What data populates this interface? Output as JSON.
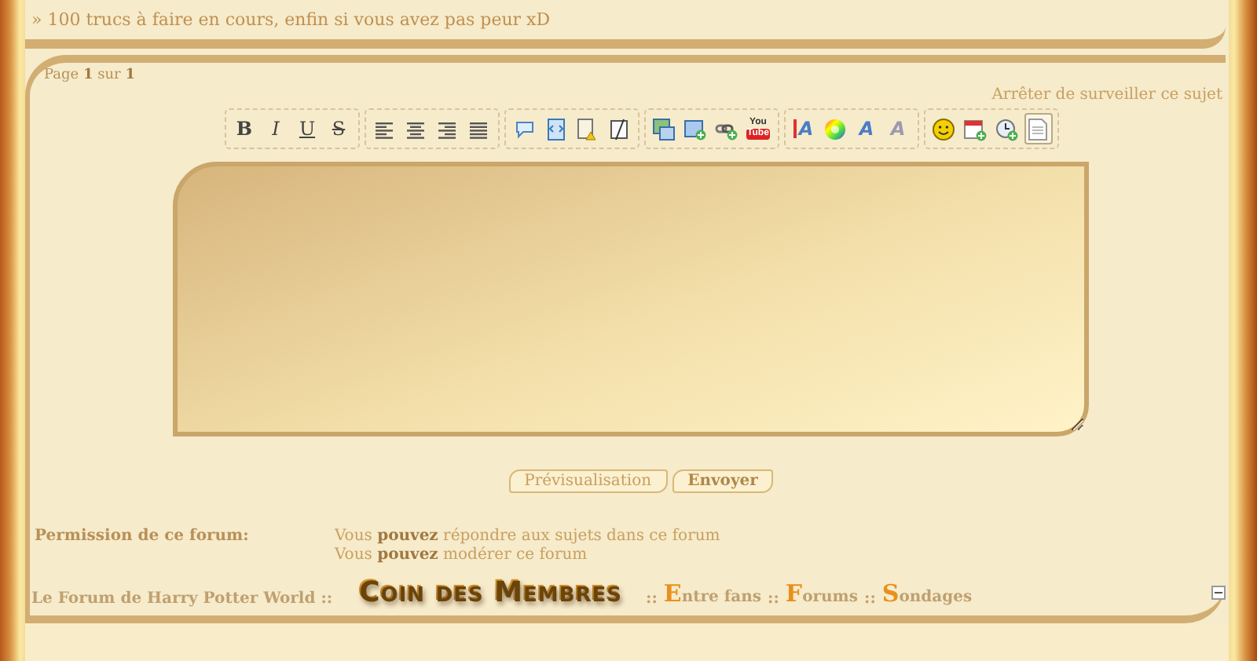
{
  "previous_post": {
    "text": "» 100 trucs à faire en cours, enfin si vous avez pas peur xD"
  },
  "pagination": {
    "text": "Page **1** sur **1**"
  },
  "watch_link": {
    "label": "Arrêter de surveiller ce sujet"
  },
  "toolbar": {
    "groups": [
      {
        "buttons": [
          {
            "kind": "bold",
            "label": "B",
            "selected": false
          },
          {
            "kind": "italic",
            "label": "I",
            "selected": false
          },
          {
            "kind": "underline",
            "label": "U",
            "selected": false
          },
          {
            "kind": "strike",
            "label": "S",
            "selected": false
          }
        ]
      },
      {
        "buttons": [
          {
            "kind": "align-left",
            "selected": false
          },
          {
            "kind": "align-center",
            "selected": false
          },
          {
            "kind": "align-right",
            "selected": false
          },
          {
            "kind": "justify",
            "selected": false
          }
        ]
      },
      {
        "buttons": [
          {
            "kind": "quote",
            "selected": false
          },
          {
            "kind": "code",
            "selected": false
          },
          {
            "kind": "spoiler",
            "selected": false
          },
          {
            "kind": "hide",
            "selected": false
          }
        ]
      },
      {
        "buttons": [
          {
            "kind": "image",
            "selected": false
          },
          {
            "kind": "host-image",
            "selected": false
          },
          {
            "kind": "link",
            "selected": false
          },
          {
            "kind": "video",
            "label": "You",
            "sublabel": "Tube",
            "selected": false
          }
        ]
      },
      {
        "buttons": [
          {
            "kind": "font-size",
            "label": "A",
            "selected": false
          },
          {
            "kind": "color",
            "selected": false
          },
          {
            "kind": "font",
            "label": "A",
            "selected": false
          },
          {
            "kind": "clear-format",
            "label": "A",
            "selected": false
          }
        ]
      },
      {
        "buttons": [
          {
            "kind": "smiley",
            "selected": false
          },
          {
            "kind": "date",
            "selected": false
          },
          {
            "kind": "time",
            "selected": false
          },
          {
            "kind": "source",
            "selected": true
          }
        ]
      }
    ]
  },
  "buttons": [
    {
      "label": "Prévisualisation",
      "primary": false
    },
    {
      "label": "Envoyer",
      "primary": true
    }
  ],
  "permissions": {
    "title": "Permission de ce forum:",
    "lines": [
      "Vous **pouvez** répondre aux sujets dans ce forum",
      "Vous **pouvez** modérer ce forum"
    ]
  },
  "breadcrumb": {
    "home": "Le Forum de Harry Potter World ::",
    "category": "Coin des Membres",
    "links": [
      {
        "label": "Entre fans",
        "separator": "::"
      },
      {
        "label": "Forums",
        "separator": "::"
      },
      {
        "label": "Sondages",
        "separator": "::"
      }
    ]
  }
}
